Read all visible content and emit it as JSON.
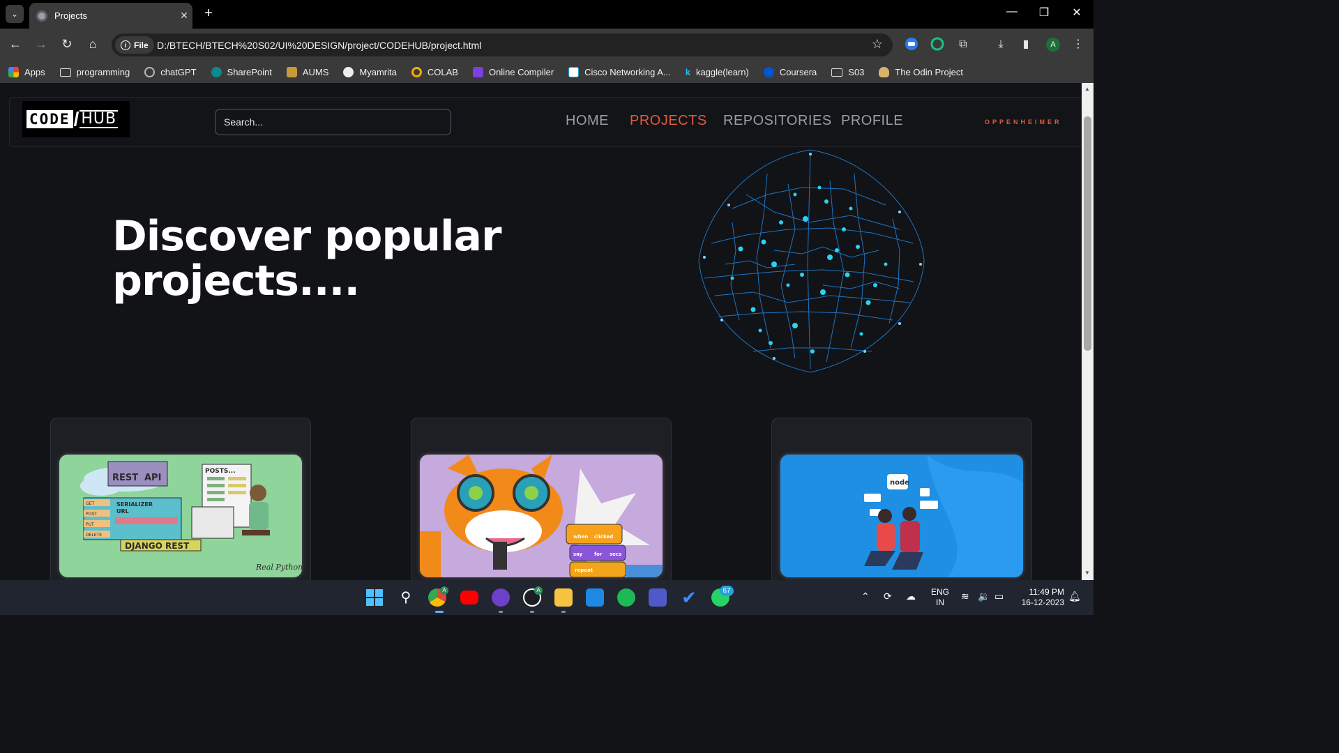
{
  "browser": {
    "tab_title": "Projects",
    "file_chip": "File",
    "url": "D:/BTECH/BTECH%20S02/UI%20DESIGN/project/CODEHUB/project.html",
    "profile_initial": "A",
    "bookmarks": [
      {
        "label": "Apps",
        "icon": "apps-grid-icon"
      },
      {
        "label": "programming",
        "icon": "folder-icon"
      },
      {
        "label": "chatGPT",
        "icon": "chatgpt-icon"
      },
      {
        "label": "SharePoint",
        "icon": "sharepoint-icon"
      },
      {
        "label": "AUMS",
        "icon": "aums-icon"
      },
      {
        "label": "Myamrita",
        "icon": "globe-icon"
      },
      {
        "label": "COLAB",
        "icon": "colab-icon"
      },
      {
        "label": "Online Compiler",
        "icon": "compiler-icon"
      },
      {
        "label": "Cisco Networking A...",
        "icon": "cisco-icon"
      },
      {
        "label": "kaggle(learn)",
        "icon": "kaggle-icon"
      },
      {
        "label": "Coursera",
        "icon": "coursera-icon"
      },
      {
        "label": "S03",
        "icon": "folder-icon"
      },
      {
        "label": "The Odin Project",
        "icon": "odin-icon"
      }
    ]
  },
  "site": {
    "logo_left": "CODE",
    "logo_right": "HUB",
    "search_placeholder": "Search...",
    "nav": [
      "HOME",
      "PROJECTS",
      "REPOSITORIES",
      "PROFILE"
    ],
    "active_nav": "PROJECTS",
    "brand_right": "OPPENHEIMER",
    "hero_line1": "Discover popular",
    "hero_line2": "projects....",
    "accent": "#e2583e",
    "cards": [
      {
        "image": "django-rest-api-illustration",
        "labels": [
          "REST",
          "API",
          "POSTS...",
          "GET",
          "POST",
          "PUT",
          "DELETE",
          "SERIALIZER",
          "URL",
          "DJANGO REST",
          "Real Python"
        ]
      },
      {
        "image": "scratch-cat-illustration",
        "labels": [
          "when",
          "clicked",
          "say",
          "for",
          "secs",
          "repeat"
        ]
      },
      {
        "image": "nodejs-illustration",
        "labels": [
          "node"
        ]
      }
    ]
  },
  "taskbar": {
    "lang": "ENG",
    "region": "IN",
    "time": "11:49 PM",
    "date": "16-12-2023",
    "whatsapp_badge": "67",
    "chrome_badge": "A",
    "github_badge": "A"
  }
}
